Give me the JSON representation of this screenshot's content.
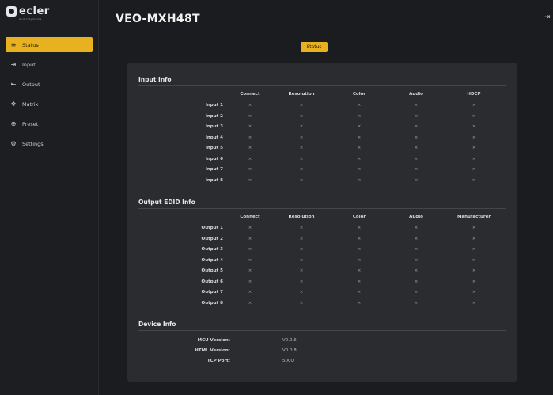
{
  "brand": {
    "name": "ecler",
    "sub": "Audio Systems"
  },
  "nav": [
    {
      "label": "Status",
      "icon": "status-icon",
      "glyph": "≡",
      "active": true
    },
    {
      "label": "Input",
      "icon": "input-icon",
      "glyph": "⇥",
      "active": false
    },
    {
      "label": "Output",
      "icon": "output-icon",
      "glyph": "⇤",
      "active": false
    },
    {
      "label": "Matrix",
      "icon": "matrix-icon",
      "glyph": "✥",
      "active": false
    },
    {
      "label": "Preset",
      "icon": "preset-icon",
      "glyph": "⊕",
      "active": false
    },
    {
      "label": "Settings",
      "icon": "settings-icon",
      "glyph": "⚙",
      "active": false
    }
  ],
  "header": {
    "title": "VEO-MXH48T"
  },
  "status_tab": "Status",
  "input_info": {
    "title": "Input Info",
    "columns": [
      "Connect",
      "Resolution",
      "Color",
      "Audio",
      "HDCP"
    ],
    "rows": [
      {
        "label": "Input 1",
        "values": [
          "×",
          "×",
          "×",
          "×",
          "×"
        ]
      },
      {
        "label": "Input 2",
        "values": [
          "×",
          "×",
          "×",
          "×",
          "×"
        ]
      },
      {
        "label": "Input 3",
        "values": [
          "×",
          "×",
          "×",
          "×",
          "×"
        ]
      },
      {
        "label": "Input 4",
        "values": [
          "×",
          "×",
          "×",
          "×",
          "×"
        ]
      },
      {
        "label": "Input 5",
        "values": [
          "×",
          "×",
          "×",
          "×",
          "×"
        ]
      },
      {
        "label": "Input 6",
        "values": [
          "×",
          "×",
          "×",
          "×",
          "×"
        ]
      },
      {
        "label": "Input 7",
        "values": [
          "×",
          "×",
          "×",
          "×",
          "×"
        ]
      },
      {
        "label": "Input 8",
        "values": [
          "×",
          "×",
          "×",
          "×",
          "×"
        ]
      }
    ]
  },
  "output_info": {
    "title": "Output EDID Info",
    "columns": [
      "Connect",
      "Resolution",
      "Color",
      "Audio",
      "Manufacturer"
    ],
    "rows": [
      {
        "label": "Output 1",
        "values": [
          "×",
          "×",
          "×",
          "×",
          "×"
        ]
      },
      {
        "label": "Output 2",
        "values": [
          "×",
          "×",
          "×",
          "×",
          "×"
        ]
      },
      {
        "label": "Output 3",
        "values": [
          "×",
          "×",
          "×",
          "×",
          "×"
        ]
      },
      {
        "label": "Output 4",
        "values": [
          "×",
          "×",
          "×",
          "×",
          "×"
        ]
      },
      {
        "label": "Output 5",
        "values": [
          "×",
          "×",
          "×",
          "×",
          "×"
        ]
      },
      {
        "label": "Output 6",
        "values": [
          "×",
          "×",
          "×",
          "×",
          "×"
        ]
      },
      {
        "label": "Output 7",
        "values": [
          "×",
          "×",
          "×",
          "×",
          "×"
        ]
      },
      {
        "label": "Output 8",
        "values": [
          "×",
          "×",
          "×",
          "×",
          "×"
        ]
      }
    ]
  },
  "device_info": {
    "title": "Device Info",
    "rows": [
      {
        "label": "MCU Version:",
        "value": "V0.0.6"
      },
      {
        "label": "HTML Version:",
        "value": "V0.0.8"
      },
      {
        "label": "TCP Port:",
        "value": "5000"
      }
    ]
  },
  "colors": {
    "accent": "#e8b11f",
    "panel": "#2b2c30",
    "background": "#1b1c1f"
  }
}
